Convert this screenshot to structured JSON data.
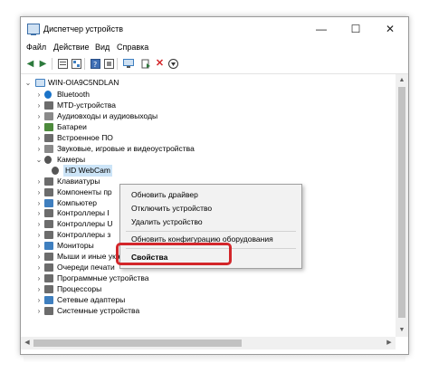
{
  "window": {
    "title": "Диспетчер устройств",
    "controls": {
      "minimize": "—",
      "maximize": "☐",
      "close": "✕"
    }
  },
  "menu": [
    "Файл",
    "Действие",
    "Вид",
    "Справка"
  ],
  "toolbar_icons": [
    "back-icon",
    "forward-icon",
    "properties-icon",
    "tree-icon",
    "help-icon",
    "driver-icon",
    "monitor-icon",
    "update-icon",
    "remove-icon",
    "download-icon"
  ],
  "tree": {
    "root": "WIN-OIA9C5NDLAN",
    "items": [
      {
        "label": "Bluetooth",
        "icon": "bluetooth-icon",
        "color": "#1a73c8"
      },
      {
        "label": "MTD-устройства",
        "icon": "mtd-icon",
        "color": "#6c6c6c"
      },
      {
        "label": "Аудиовходы и аудиовыходы",
        "icon": "audio-icon",
        "color": "#8a8a8a"
      },
      {
        "label": "Батареи",
        "icon": "battery-icon",
        "color": "#4d8a3c"
      },
      {
        "label": "Встроенное ПО",
        "icon": "firmware-icon",
        "color": "#6c6c6c"
      },
      {
        "label": "Звуковые, игровые и видеоустройства",
        "icon": "sound-icon",
        "color": "#8a8a8a"
      },
      {
        "label": "Камеры",
        "icon": "camera-icon",
        "color": "#555555",
        "expanded": true
      },
      {
        "label": "HD WebCam",
        "icon": "webcam-icon",
        "color": "#555555",
        "child": true,
        "selected": true
      },
      {
        "label": "Клавиатуры",
        "icon": "keyboard-icon",
        "color": "#6c6c6c"
      },
      {
        "label": "Компоненты пр",
        "icon": "component-icon",
        "color": "#6c6c6c"
      },
      {
        "label": "Компьютер",
        "icon": "computer-icon",
        "color": "#3f7fbf"
      },
      {
        "label": "Контроллеры I",
        "icon": "controller-icon",
        "color": "#6c6c6c"
      },
      {
        "label": "Контроллеры U",
        "icon": "usb-icon",
        "color": "#6c6c6c"
      },
      {
        "label": "Контроллеры з",
        "icon": "storage-icon",
        "color": "#6c6c6c"
      },
      {
        "label": "Мониторы",
        "icon": "monitor-icon",
        "color": "#3f7fbf"
      },
      {
        "label": "Мыши и иные указывающие устройства",
        "icon": "mouse-icon",
        "color": "#6c6c6c"
      },
      {
        "label": "Очереди печати",
        "icon": "printer-icon",
        "color": "#6c6c6c"
      },
      {
        "label": "Программные устройства",
        "icon": "software-icon",
        "color": "#6c6c6c"
      },
      {
        "label": "Процессоры",
        "icon": "cpu-icon",
        "color": "#6c6c6c"
      },
      {
        "label": "Сетевые адаптеры",
        "icon": "network-icon",
        "color": "#3f7fbf"
      },
      {
        "label": "Системные устройства",
        "icon": "system-icon",
        "color": "#6c6c6c"
      }
    ]
  },
  "context_menu": {
    "items": [
      "Обновить драйвер",
      "Отключить устройство",
      "Удалить устройство",
      "Обновить конфигурацию оборудования",
      "Свойства"
    ],
    "highlight_color": "#d3262a"
  }
}
